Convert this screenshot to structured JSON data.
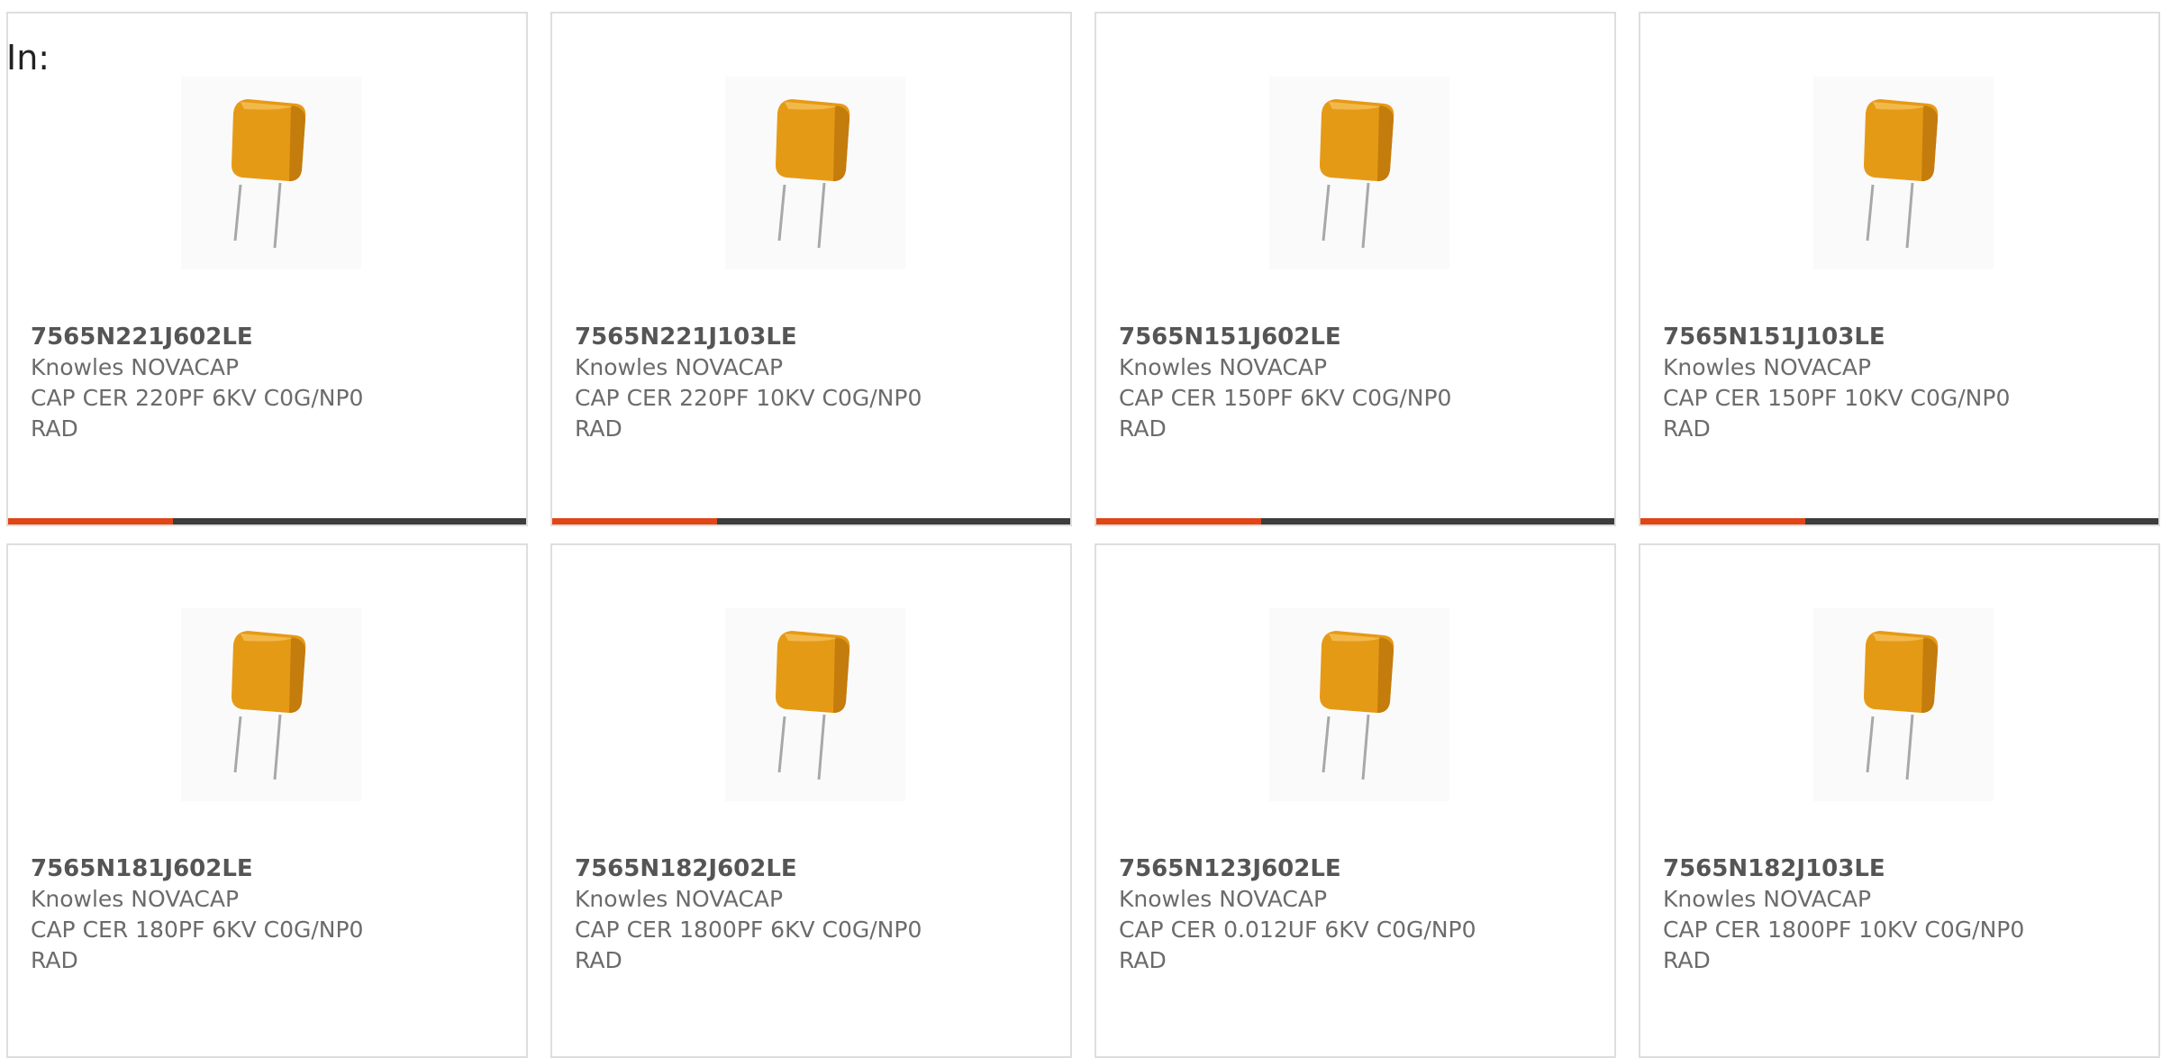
{
  "filter_label": "In:",
  "colors": {
    "accent": "#e04616",
    "bar": "#3d3d3d",
    "capacitor": "#e59a16"
  },
  "products": [
    {
      "part": "7565N221J602LE",
      "maker": "Knowles NOVACAP",
      "desc1": "CAP CER 220PF 6KV C0G/NP0",
      "desc2": "RAD",
      "icon": "radial-capacitor-icon"
    },
    {
      "part": "7565N221J103LE",
      "maker": "Knowles NOVACAP",
      "desc1": "CAP CER 220PF 10KV C0G/NP0",
      "desc2": "RAD",
      "icon": "radial-capacitor-icon"
    },
    {
      "part": "7565N151J602LE",
      "maker": "Knowles NOVACAP",
      "desc1": "CAP CER 150PF 6KV C0G/NP0",
      "desc2": "RAD",
      "icon": "radial-capacitor-icon"
    },
    {
      "part": "7565N151J103LE",
      "maker": "Knowles NOVACAP",
      "desc1": "CAP CER 150PF 10KV C0G/NP0",
      "desc2": "RAD",
      "icon": "radial-capacitor-icon"
    },
    {
      "part": "7565N181J602LE",
      "maker": "Knowles NOVACAP",
      "desc1": "CAP CER 180PF 6KV C0G/NP0",
      "desc2": "RAD",
      "icon": "radial-capacitor-icon"
    },
    {
      "part": "7565N182J602LE",
      "maker": "Knowles NOVACAP",
      "desc1": "CAP CER 1800PF 6KV C0G/NP0",
      "desc2": "RAD",
      "icon": "radial-capacitor-icon"
    },
    {
      "part": "7565N123J602LE",
      "maker": "Knowles NOVACAP",
      "desc1": "CAP CER 0.012UF 6KV C0G/NP0",
      "desc2": "RAD",
      "icon": "radial-capacitor-icon"
    },
    {
      "part": "7565N182J103LE",
      "maker": "Knowles NOVACAP",
      "desc1": "CAP CER 1800PF 10KV C0G/NP0",
      "desc2": "RAD",
      "icon": "radial-capacitor-icon"
    }
  ]
}
